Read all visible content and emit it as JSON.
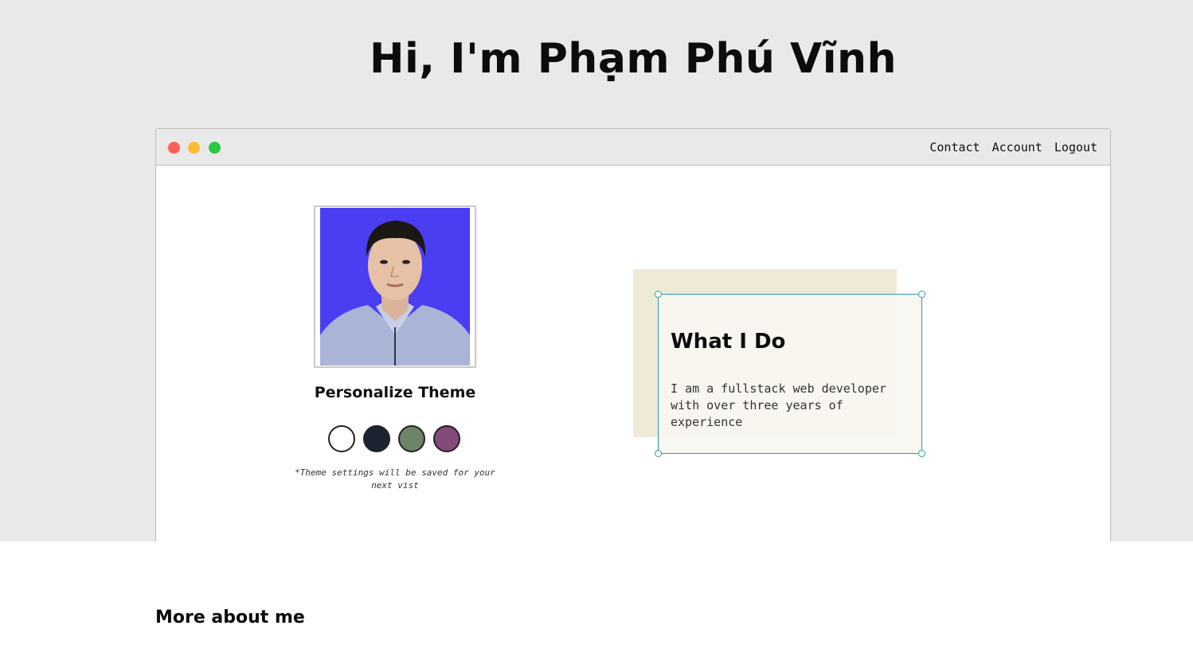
{
  "hero": {
    "title": "Hi, I'm Phạm Phú Vĩnh"
  },
  "window": {
    "nav": [
      "Contact",
      "Account",
      "Logout"
    ]
  },
  "profile": {
    "photo_alt": "profile-photo",
    "theme_title": "Personalize Theme",
    "swatches": [
      {
        "name": "white",
        "color": "#ffffff"
      },
      {
        "name": "navy",
        "color": "#1b2430"
      },
      {
        "name": "sage",
        "color": "#6f8466"
      },
      {
        "name": "plum",
        "color": "#834a7a"
      }
    ],
    "theme_note": "*Theme settings will be saved for your next vist"
  },
  "card": {
    "title": "What I Do",
    "text": "I am a fullstack web developer with over three years of experience"
  },
  "section": {
    "more_title": "More about me"
  }
}
